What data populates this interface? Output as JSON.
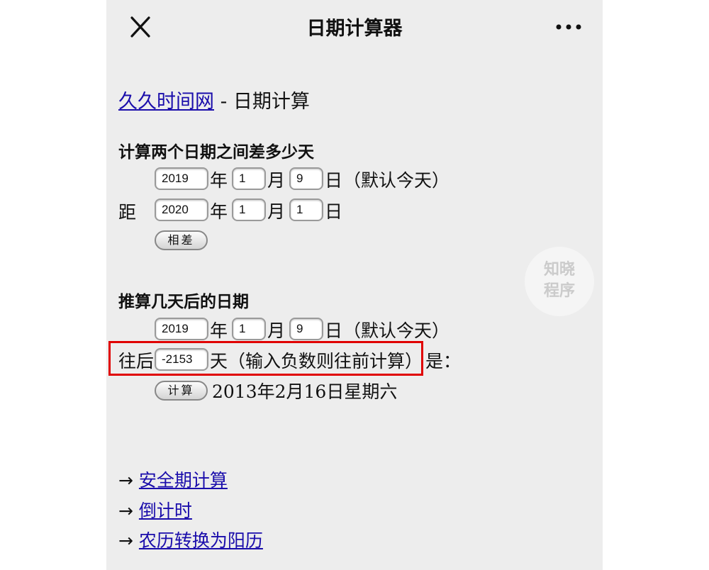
{
  "navbar": {
    "title": "日期计算器",
    "close_icon": "close-icon",
    "more_icon": "more-dots-icon"
  },
  "header": {
    "site_link": "久久时间网",
    "separator": " - ",
    "page_title": "日期计算"
  },
  "section_diff": {
    "heading": "计算两个日期之间差多少天",
    "row1": {
      "year": "2019",
      "month": "1",
      "day": "9",
      "year_unit": "年",
      "month_unit": "月",
      "day_unit": "日",
      "note": "（默认今天）"
    },
    "row2": {
      "prefix": "距",
      "year": "2020",
      "month": "1",
      "day": "1",
      "year_unit": "年",
      "month_unit": "月",
      "day_unit": "日"
    },
    "button_label": "相差"
  },
  "section_add": {
    "heading": "推算几天后的日期",
    "row1": {
      "year": "2019",
      "month": "1",
      "day": "9",
      "year_unit": "年",
      "month_unit": "月",
      "day_unit": "日",
      "note": "（默认今天）"
    },
    "offset_prefix": "往后",
    "offset_value": "-2153",
    "offset_suffix": "天（输入负数则往前计算）",
    "offset_tail": "是：",
    "button_label": "计算",
    "result": "2013年2月16日星期六"
  },
  "links": {
    "arrow": "→",
    "items": [
      "安全期计算",
      "倒计时",
      "农历转换为阳历"
    ]
  },
  "watermark": {
    "line1": "知晓",
    "line2": "程序"
  },
  "colors": {
    "link": "#1a0dab",
    "highlight": "#e00000",
    "background": "#ededed"
  }
}
